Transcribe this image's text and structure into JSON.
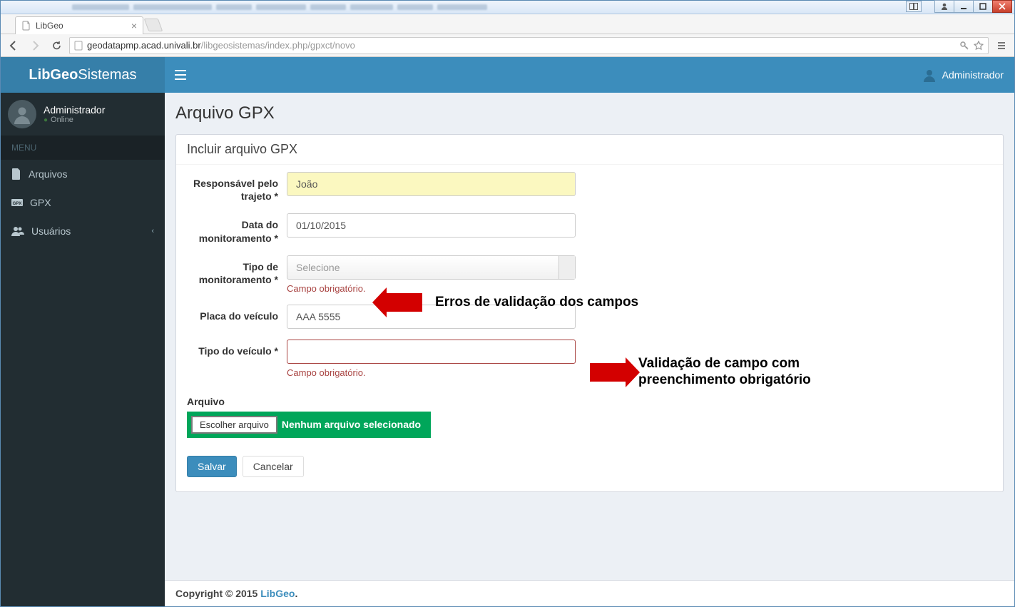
{
  "os": {
    "pane": "▯▯",
    "user": "👤",
    "min": "▁",
    "max": "▭",
    "close": "✕"
  },
  "browser": {
    "tab_title": "LibGeo",
    "url_host": "geodatapmp.acad.univali.br",
    "url_path": "/libgeosistemas/index.php/gpxct/novo"
  },
  "app": {
    "logo_bold": "LibGeo",
    "logo_light": "Sistemas",
    "top_user": "Administrador"
  },
  "sidebar": {
    "user_name": "Administrador",
    "user_status": "Online",
    "menu_header": "MENU",
    "items": [
      {
        "label": "Arquivos",
        "icon": "file"
      },
      {
        "label": "GPX",
        "icon": "gpx"
      },
      {
        "label": "Usuários",
        "icon": "users",
        "chev": true
      }
    ]
  },
  "page": {
    "title": "Arquivo GPX",
    "box_title": "Incluir arquivo GPX"
  },
  "form": {
    "responsavel_label": "Responsável pelo trajeto *",
    "responsavel_value": "João",
    "data_label": "Data do monitoramento *",
    "data_value": "01/10/2015",
    "tipo_mon_label": "Tipo de monitoramento *",
    "tipo_mon_placeholder": "Selecione",
    "tipo_mon_error": "Campo obrigatório.",
    "placa_label": "Placa do veículo",
    "placa_value": "AAA 5555",
    "tipo_vei_label": "Tipo do veículo *",
    "tipo_vei_value": "",
    "tipo_vei_error": "Campo obrigatório.",
    "arquivo_label": "Arquivo",
    "choose_file": "Escolher arquivo",
    "file_status": "Nenhum arquivo selecionado",
    "save": "Salvar",
    "cancel": "Cancelar"
  },
  "footer": {
    "copyright_prefix": "Copyright © 2015 ",
    "link": "LibGeo",
    "suffix": "."
  },
  "annotations": {
    "err1": "Erros de validação dos campos",
    "err2a": "Validação de campo com",
    "err2b": "preenchimento obrigatório"
  }
}
